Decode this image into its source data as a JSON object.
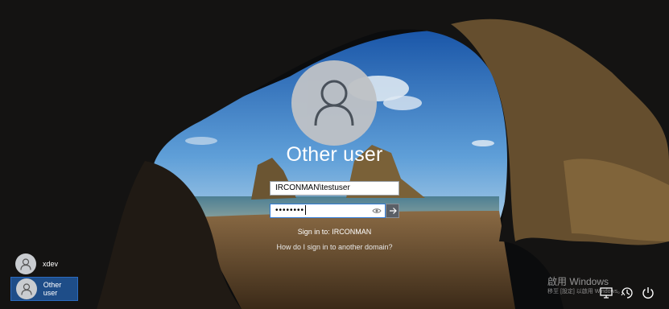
{
  "login": {
    "title": "Other user",
    "username_value": "IRCONMAN\\testuser",
    "password_masked": "••••••••",
    "sign_in_to": "Sign in to: IRCONMAN",
    "other_domain_link": "How do I sign in to another domain?"
  },
  "user_switcher": {
    "items": [
      {
        "label": "xdev",
        "selected": false
      },
      {
        "label": "Other user",
        "selected": true
      }
    ]
  },
  "watermark": {
    "title": "啟用 Windows",
    "subtitle": "移至 [設定] 以啟用 Windows。"
  },
  "tray": {
    "icons": [
      "network-icon",
      "ease-of-access-icon",
      "power-icon"
    ]
  },
  "colors": {
    "selected_bg": "#1e4d88",
    "field_focus_border": "#2f7ad6"
  }
}
